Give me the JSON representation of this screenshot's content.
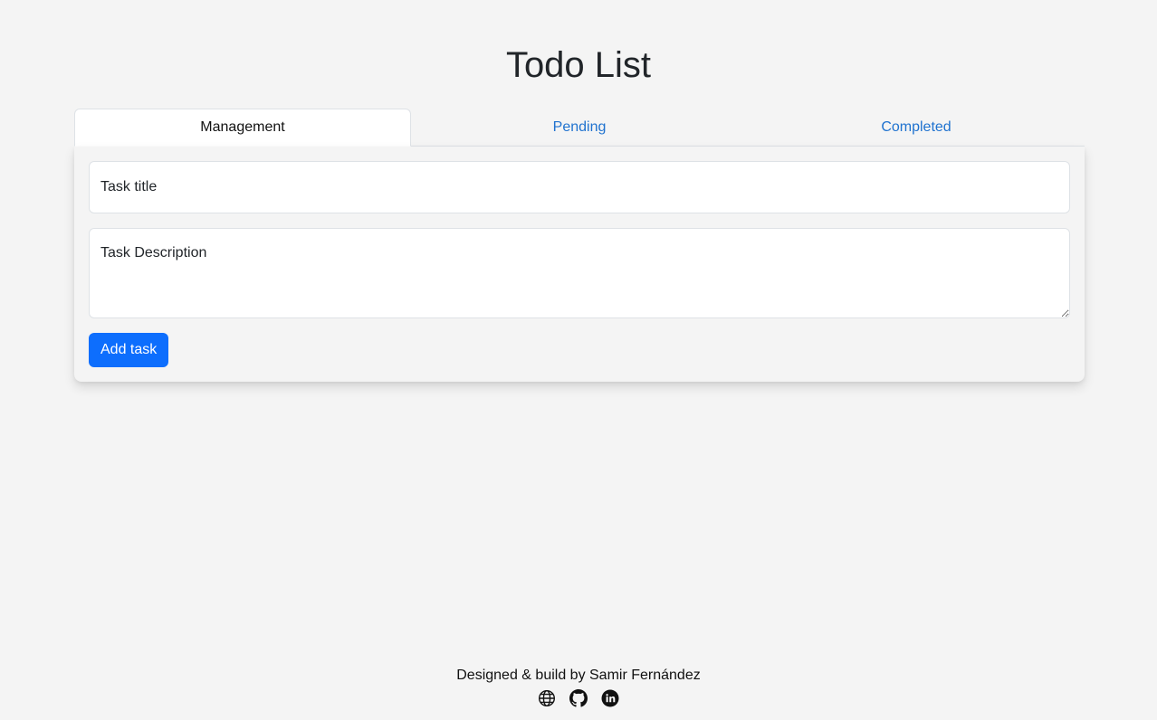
{
  "header": {
    "title": "Todo List"
  },
  "tabs": [
    {
      "label": "Management",
      "active": true
    },
    {
      "label": "Pending",
      "active": false
    },
    {
      "label": "Completed",
      "active": false
    }
  ],
  "form": {
    "title_placeholder": "Task title",
    "description_placeholder": "Task Description",
    "title_value": "",
    "description_value": "",
    "add_button_label": "Add task"
  },
  "footer": {
    "credit": "Designed & build by Samir Fernández",
    "links": [
      {
        "icon": "globe-icon"
      },
      {
        "icon": "github-icon"
      },
      {
        "icon": "linkedin-icon"
      }
    ]
  },
  "colors": {
    "background": "#f4f4f4",
    "accent": "#0d6efd",
    "tab_link": "#1f72cf",
    "text": "#212529"
  }
}
